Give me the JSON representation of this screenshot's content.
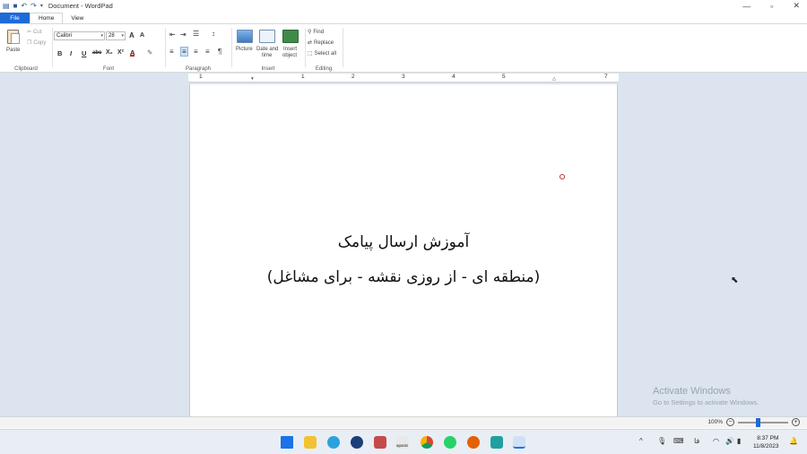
{
  "titlebar": {
    "title": "Document - WordPad",
    "minimize_glyph": "—",
    "restore_glyph": "▫",
    "close_glyph": "✕"
  },
  "tabs": [
    {
      "label": "File"
    },
    {
      "label": "Home"
    },
    {
      "label": "View"
    }
  ],
  "ribbon": {
    "clipboard": {
      "label": "Clipboard",
      "paste": "Paste",
      "cut": "Cut",
      "copy": "Copy"
    },
    "font": {
      "label": "Font",
      "family": "Calibri",
      "size": "28",
      "bold": "B",
      "italic": "I",
      "underline": "U",
      "strike": "abc",
      "subscript": "X₂",
      "superscript": "X²",
      "grow": "A",
      "shrink": "A"
    },
    "paragraph": {
      "label": "Paragraph"
    },
    "insert": {
      "label": "Insert",
      "picture": "Picture",
      "datetime_1": "Date and",
      "datetime_2": "time",
      "object_1": "Insert",
      "object_2": "object"
    },
    "editing": {
      "label": "Editing",
      "find": "Find",
      "replace": "Replace",
      "select_all": "Select all"
    }
  },
  "ruler": {
    "numbers": [
      "1",
      "1",
      "2",
      "3",
      "4",
      "5",
      "6",
      "7"
    ]
  },
  "document": {
    "line1": "آموزش ارسال پیامک",
    "line2": "(منطقه ای - از روزی نقشه - برای مشاغل)"
  },
  "watermark": {
    "title": "Activate Windows",
    "subtitle": "Go to Settings to activate Windows."
  },
  "status": {
    "zoom": "100%",
    "minus": "−",
    "plus": "+"
  },
  "taskbar": {
    "app_labels": [
      "aparat"
    ],
    "lang": "فا",
    "time": "8:37 PM",
    "date": "11/8/2023"
  }
}
